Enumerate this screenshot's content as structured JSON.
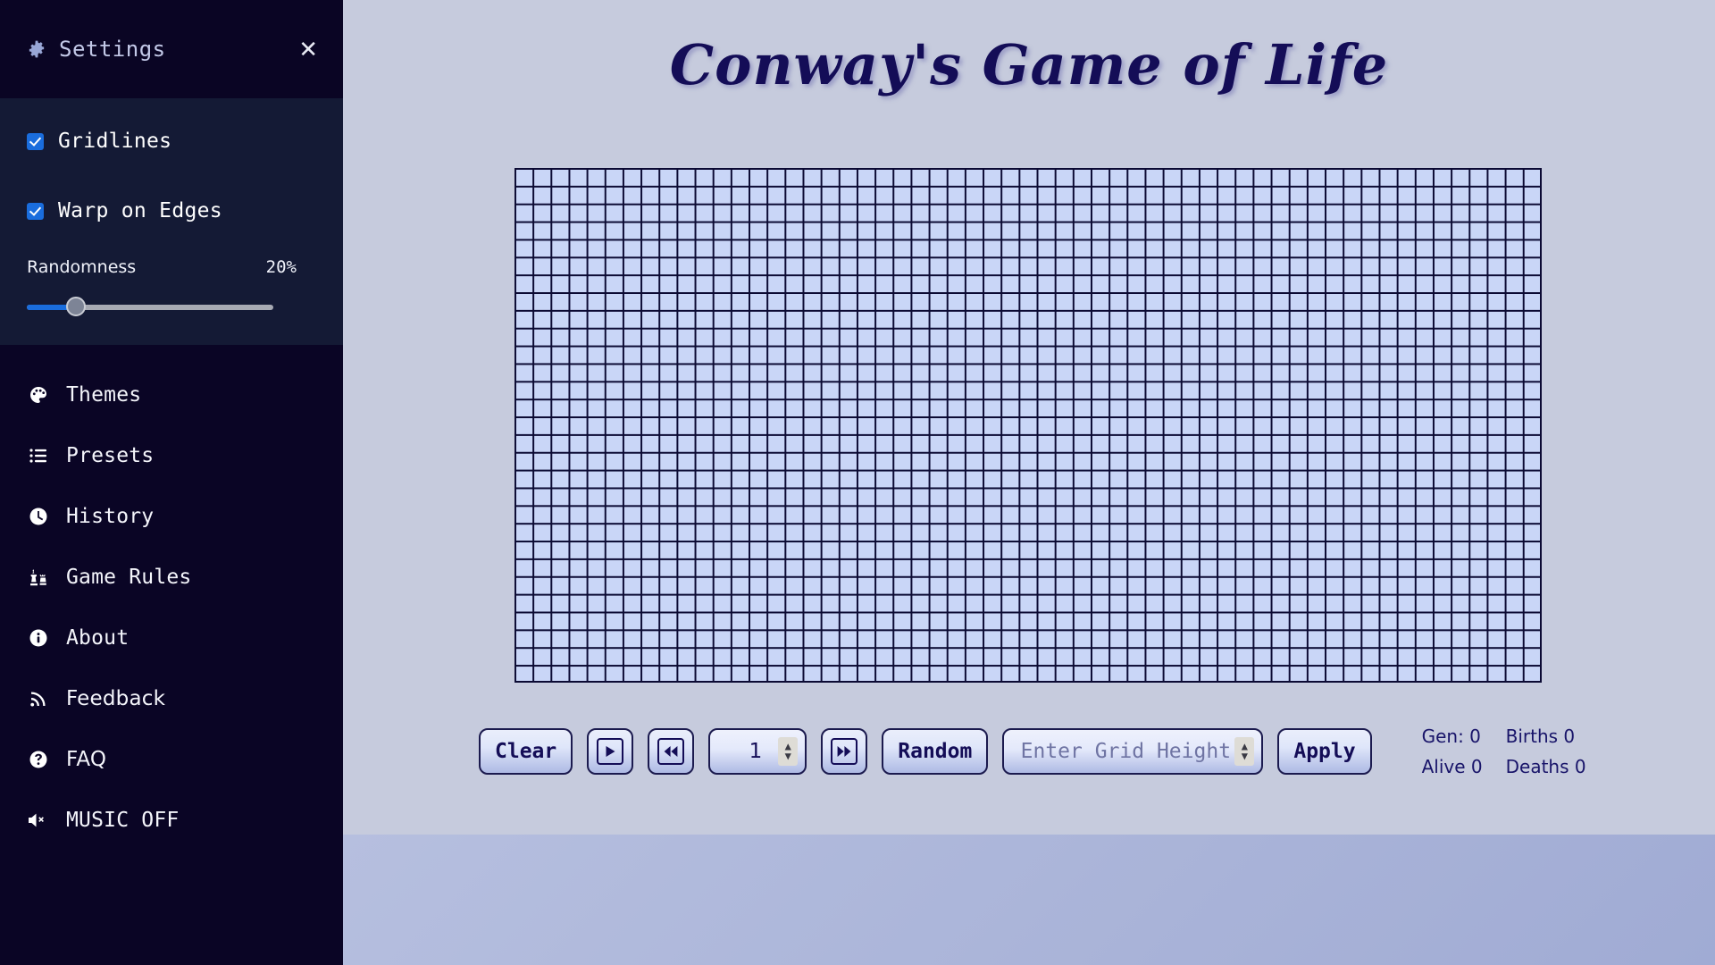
{
  "sidebar": {
    "title": "Settings",
    "gear_icon": "gear-icon",
    "close_icon": "close-icon",
    "settings": {
      "gridlines": {
        "label": "Gridlines",
        "checked": true
      },
      "warp": {
        "label": "Warp on Edges",
        "checked": true
      },
      "randomness": {
        "label": "Randomness",
        "value": "20%",
        "percent": 20
      }
    },
    "menu": [
      {
        "label": "Themes",
        "icon": "palette-icon"
      },
      {
        "label": "Presets",
        "icon": "list-icon"
      },
      {
        "label": "History",
        "icon": "clock-icon"
      },
      {
        "label": "Game Rules",
        "icon": "chess-icon"
      },
      {
        "label": "About",
        "icon": "info-icon"
      },
      {
        "label": "Feedback",
        "icon": "rss-icon"
      },
      {
        "label": "FAQ",
        "icon": "question-circle-icon"
      },
      {
        "label": "MUSIC OFF",
        "icon": "speaker-mute-icon"
      }
    ]
  },
  "main": {
    "title": "Conway's Game of Life",
    "grid": {
      "columns": 57,
      "rows": 29,
      "cell_state": "all-dead"
    },
    "controls": {
      "clear": "Clear",
      "play_icon": "play-icon",
      "rewind_icon": "rewind-icon",
      "step_value": "1",
      "forward_icon": "fast-forward-icon",
      "random": "Random",
      "grid_height_placeholder": "Enter Grid Height",
      "grid_height_value": "",
      "apply": "Apply"
    },
    "stats": {
      "gen": "Gen: 0",
      "births": "Births 0",
      "alive": "Alive 0",
      "deaths": "Deaths 0"
    }
  },
  "colors": {
    "sidebar_bg": "#0a0525",
    "settings_panel_bg": "#141a35",
    "main_bg": "#c6cbdd",
    "grid_cell": "#c9d6f7",
    "grid_line": "#0b0a33",
    "accent": "#1a6ddd",
    "title_navy": "#140d57"
  }
}
